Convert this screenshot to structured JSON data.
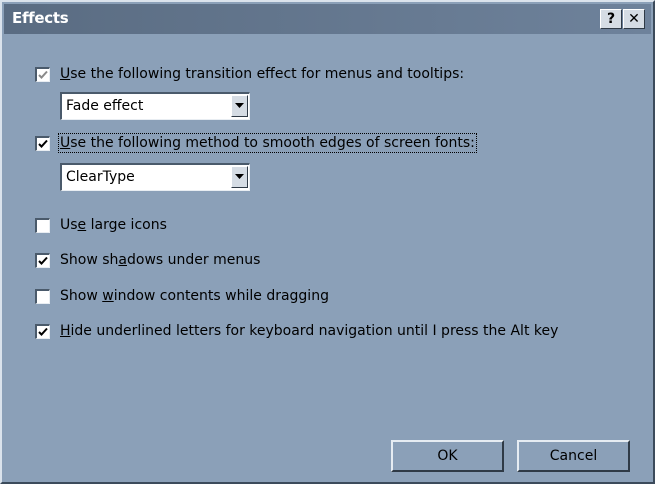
{
  "window": {
    "title": "Effects",
    "help_button": "?",
    "close_button": "✕"
  },
  "options": [
    {
      "pre": "",
      "ul": "U",
      "post": "se the following transition effect for menus and tooltips:",
      "checked": true,
      "disabled": true
    },
    {
      "pre": "",
      "ul": "U",
      "post": "se the following method to smooth edges of screen fonts:",
      "checked": true,
      "disabled": false
    },
    {
      "pre": "Us",
      "ul": "e",
      "post": " large icons",
      "checked": false,
      "disabled": false
    },
    {
      "pre": "Show sh",
      "ul": "a",
      "post": "dows under menus",
      "checked": true,
      "disabled": false
    },
    {
      "pre": "Show ",
      "ul": "w",
      "post": "indow contents while dragging",
      "checked": false,
      "disabled": false
    },
    {
      "pre": "",
      "ul": "H",
      "post": "ide underlined letters for keyboard navigation until I press the Alt key",
      "checked": true,
      "disabled": false
    }
  ],
  "transition_select": {
    "value": "Fade effect"
  },
  "smoothing_select": {
    "value": "ClearType"
  },
  "buttons": {
    "ok": "OK",
    "cancel": "Cancel"
  }
}
